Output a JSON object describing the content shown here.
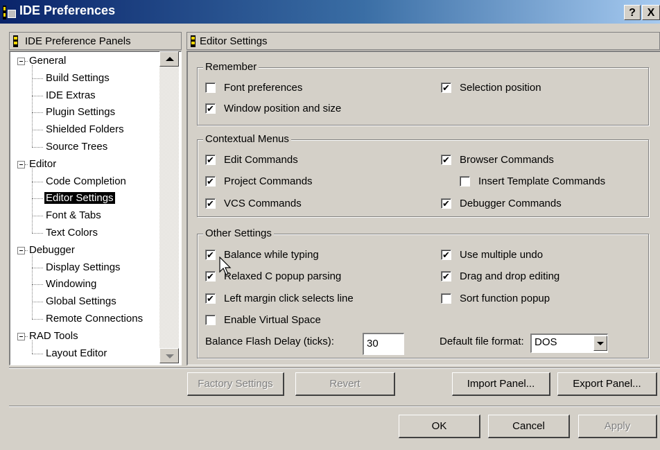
{
  "window": {
    "title": "IDE Preferences",
    "help_btn": "?",
    "close_btn": "X"
  },
  "tree": {
    "header": "IDE Preference Panels",
    "nodes": [
      {
        "label": "General",
        "level": 0
      },
      {
        "label": "Build Settings",
        "level": 1
      },
      {
        "label": "IDE Extras",
        "level": 1
      },
      {
        "label": "Plugin Settings",
        "level": 1
      },
      {
        "label": "Shielded Folders",
        "level": 1
      },
      {
        "label": "Source Trees",
        "level": 1
      },
      {
        "label": "Editor",
        "level": 0
      },
      {
        "label": "Code Completion",
        "level": 1
      },
      {
        "label": "Editor Settings",
        "level": 1,
        "selected": true
      },
      {
        "label": "Font & Tabs",
        "level": 1
      },
      {
        "label": "Text Colors",
        "level": 1
      },
      {
        "label": "Debugger",
        "level": 0
      },
      {
        "label": "Display Settings",
        "level": 1
      },
      {
        "label": "Windowing",
        "level": 1
      },
      {
        "label": "Global Settings",
        "level": 1
      },
      {
        "label": "Remote Connections",
        "level": 1
      },
      {
        "label": "RAD Tools",
        "level": 0
      },
      {
        "label": "Layout Editor",
        "level": 1
      }
    ]
  },
  "panel": {
    "header": "Editor Settings",
    "remember": {
      "title": "Remember",
      "font_preferences": {
        "label": "Font preferences",
        "checked": false
      },
      "selection_position": {
        "label": "Selection position",
        "checked": true
      },
      "window_position": {
        "label": "Window position and size",
        "checked": true
      }
    },
    "contextual": {
      "title": "Contextual Menus",
      "edit_commands": {
        "label": "Edit Commands",
        "checked": true
      },
      "browser_commands": {
        "label": "Browser Commands",
        "checked": true
      },
      "project_commands": {
        "label": "Project Commands",
        "checked": true
      },
      "insert_template": {
        "label": "Insert Template Commands",
        "checked": false
      },
      "vcs_commands": {
        "label": "VCS Commands",
        "checked": true
      },
      "debugger_commands": {
        "label": "Debugger Commands",
        "checked": true
      }
    },
    "other": {
      "title": "Other Settings",
      "balance_typing": {
        "label": "Balance while typing",
        "checked": true
      },
      "multiple_undo": {
        "label": "Use multiple undo",
        "checked": true
      },
      "relaxed_popup": {
        "label": "Relaxed C popup parsing",
        "checked": true
      },
      "drag_drop": {
        "label": "Drag and drop editing",
        "checked": true
      },
      "left_margin": {
        "label": "Left margin click selects line",
        "checked": true
      },
      "sort_popup": {
        "label": "Sort function popup",
        "checked": false
      },
      "virtual_space": {
        "label": "Enable Virtual Space",
        "checked": false
      },
      "flash_delay_label": "Balance Flash Delay (ticks):",
      "flash_delay_value": "30",
      "file_format_label": "Default file format:",
      "file_format_value": "DOS"
    }
  },
  "buttons": {
    "factory": "Factory Settings",
    "revert": "Revert",
    "import": "Import Panel...",
    "export": "Export Panel...",
    "ok": "OK",
    "cancel": "Cancel",
    "apply": "Apply"
  },
  "check_mark": "✔"
}
